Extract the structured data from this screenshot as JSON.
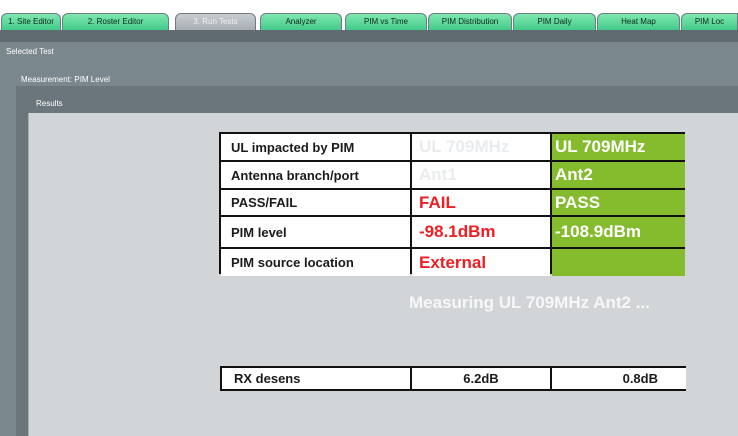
{
  "tabs": [
    {
      "label": "1. Site Editor",
      "active": false
    },
    {
      "label": "2. Roster Editor",
      "active": false
    },
    {
      "label": "3. Run Tests",
      "active": true
    },
    {
      "label": "Analyzer",
      "active": false
    },
    {
      "label": "PIM vs Time",
      "active": false
    },
    {
      "label": "PIM Distribution",
      "active": false
    },
    {
      "label": "PIM Daily",
      "active": false
    },
    {
      "label": "Heat Map",
      "active": false
    },
    {
      "label": "PIM Loc",
      "active": false
    }
  ],
  "panels": {
    "selected_test_label": "Selected Test",
    "measurement_label": "Measurement:  PIM Level",
    "results_label": "Results"
  },
  "results_table": {
    "rows": [
      {
        "label": "UL impacted by PIM",
        "ant1": "UL 709MHz",
        "ant2": "UL 709MHz"
      },
      {
        "label": "Antenna branch/port",
        "ant1": "Ant1",
        "ant2": "Ant2"
      },
      {
        "label": "PASS/FAIL",
        "ant1": "FAIL",
        "ant2": "PASS"
      },
      {
        "label": "PIM level",
        "ant1": "-98.1dBm",
        "ant2": "-108.9dBm"
      },
      {
        "label": "PIM source location",
        "ant1": "External",
        "ant2": ""
      }
    ]
  },
  "status_message": "Measuring UL 709MHz Ant2 ...",
  "rx_desens": {
    "label": "RX desens",
    "ant1": "6.2dB",
    "ant2": "0.8dB"
  },
  "colors": {
    "tab_green": "#43c98a",
    "pass_green": "#84bc2e",
    "fail_red": "#ee1f23",
    "panel_gray": "#7a878d",
    "inner_gray": "#d2d5d8"
  }
}
